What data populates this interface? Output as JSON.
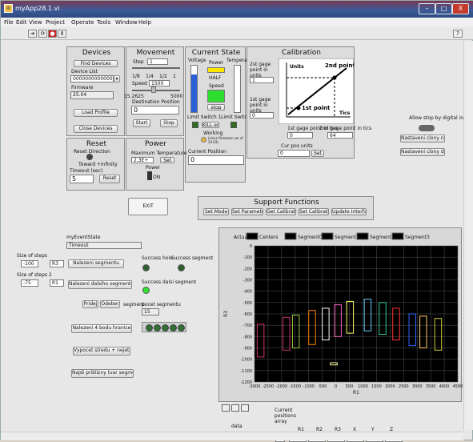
{
  "window": {
    "title": "myApp28.1.vi",
    "min": "–",
    "max": "□",
    "close": "X"
  },
  "menu": [
    "File",
    "Edit",
    "View",
    "Project",
    "Operate",
    "Tools",
    "Window",
    "Help"
  ],
  "devices": {
    "title": "Devices",
    "find": "Find Devices",
    "list_label": "Device List",
    "list_value": "000000000000007615",
    "firmware_label": "Firmware",
    "firmware_value": "25.04",
    "load": "Load Profile",
    "close": "Close Devices"
  },
  "movement": {
    "title": "Movement",
    "step_label": "Step",
    "step_value": "1",
    "frac1": "1/8",
    "frac2": "1/4",
    "frac3": "1/2",
    "frac4": "1",
    "speed_label": "Speed",
    "speed_value": "1500",
    "range_min": "15.2625",
    "range_max": "5000",
    "dest_label": "Destination Position",
    "dest_value": "0",
    "start": "Start",
    "stop": "Stop"
  },
  "state": {
    "title": "Current State",
    "voltage": "Voltage",
    "power": "Power",
    "temperature": "Temperature",
    "half": "HALF",
    "speed": "Speed",
    "stop": "stop",
    "ls1": "Limit Switch 1",
    "ls2": "Limit Switch 2",
    "kill": "KILL error",
    "working": "Working",
    "note": "(since firmware ver of 24.03)",
    "cur_pos_label": "Current Position",
    "cur_pos_value": "0"
  },
  "calibration": {
    "title": "Calibration",
    "p2_label": "2st gage point in units",
    "p2_value": "1",
    "p1_label": "1st gage point in units",
    "p1_value": "0",
    "units": "Units",
    "tics": "Tics",
    "second": "2nd point",
    "first": "1st point",
    "t1_label": "1st gage point in tics",
    "t1_value": "0",
    "t2_label": "2nd gage point in tics",
    "t2_value": "64",
    "cur_label": "Cur pos units",
    "cur_value": "0",
    "set": "Set"
  },
  "reset": {
    "title": "Reset",
    "dir_label": "Reset Direction",
    "dir_value": "Toward +infinity",
    "timeout_label": "Timeout (sec)",
    "timeout_value": "5",
    "btn": "Reset"
  },
  "power": {
    "title": "Power",
    "max_temp_label": "Maximum Temperature",
    "max_temp_value": "2,3E+",
    "set": "Set",
    "power_label": "Power",
    "on": "ON"
  },
  "right": {
    "allow": "Allow stop by digital input",
    "up": "Nastaveni clony nahoru",
    "down": "Nastaveni clony dolů"
  },
  "support": {
    "title": "Support Functions",
    "buttons": [
      "Set Mode",
      "Set Parameters",
      "Get Calibration",
      "Set Calibration",
      "Update Interface"
    ]
  },
  "exit": "EXIT",
  "event": {
    "label": "myEventState",
    "value": "Timeout"
  },
  "steps": {
    "label1": "Size of steps",
    "value1": "-100",
    "r1": "R3",
    "label2": "Size of steps 2",
    "value2": "-75",
    "r2": "R1"
  },
  "seg_buttons": {
    "b1": "Nalezeni segmentu",
    "b2": "Nalezeni dalsiho segmentu",
    "pridej": "Pridej",
    "odeber": "Odeber",
    "segment": "segment",
    "b3": "Nalezeni 4 bodu hranice",
    "b4": "Vypocet stredu + nejeti",
    "b5": "Najdi priblizny tvar segmentu"
  },
  "success": {
    "hole": "Success hole",
    "segment": "Success segment",
    "dalsi": "Success dalsi segment",
    "pocet_label": "pocet segmentu",
    "pocet_value": "15"
  },
  "data_ctrl": {
    "label": "data",
    "index": "0"
  },
  "positions": {
    "label": "Current positions array",
    "index": "0",
    "headers": [
      "R1",
      "R2",
      "R3",
      "X",
      "Y",
      "Z"
    ],
    "values": [
      "0",
      "0,5",
      "0",
      "0,5",
      "0,5",
      "0,5"
    ]
  },
  "chart_data": {
    "type": "line",
    "legend": [
      "Actual",
      "Centers",
      "Segment0",
      "Segment1",
      "Segment2",
      "Segment3"
    ],
    "xlabel": "R1",
    "ylabel": "R3",
    "xlim": [
      -3000,
      4500
    ],
    "ylim": [
      -1200,
      0
    ],
    "xticks": [
      "-3000",
      "-2500",
      "-2000",
      "-1500",
      "-1000",
      "-500",
      "0",
      "500",
      "1000",
      "1500",
      "2000",
      "2500",
      "3000",
      "3500",
      "4000",
      "4500"
    ],
    "yticks": [
      "0",
      "-100",
      "-200",
      "-300",
      "-400",
      "-500",
      "-600",
      "-700",
      "-800",
      "-900",
      "-1000",
      "-1100",
      "-1200"
    ],
    "segments": [
      {
        "color": "#cc3366",
        "x": [
          -2900,
          -2650
        ],
        "y": [
          -980,
          -690
        ]
      },
      {
        "color": "#cc3366",
        "x": [
          -1950,
          -1700
        ],
        "y": [
          -920,
          -630
        ]
      },
      {
        "color": "#99cc33",
        "x": [
          -1600,
          -1350
        ],
        "y": [
          -900,
          -610
        ]
      },
      {
        "color": "#ff8800",
        "x": [
          -1000,
          -750
        ],
        "y": [
          -870,
          -570
        ]
      },
      {
        "color": "#ffffff",
        "x": [
          -500,
          -250
        ],
        "y": [
          -830,
          -550
        ]
      },
      {
        "color": "#ff66cc",
        "x": [
          -50,
          200
        ],
        "y": [
          -800,
          -520
        ]
      },
      {
        "color": "#ffff66",
        "x": [
          400,
          650
        ],
        "y": [
          -770,
          -490
        ]
      },
      {
        "color": "#66ccff",
        "x": [
          1050,
          1300
        ],
        "y": [
          -750,
          -470
        ]
      },
      {
        "color": "#33cc99",
        "x": [
          1600,
          1850
        ],
        "y": [
          -780,
          -500
        ]
      },
      {
        "color": "#ff3333",
        "x": [
          2100,
          2350
        ],
        "y": [
          -830,
          -550
        ]
      },
      {
        "color": "#3366ff",
        "x": [
          2700,
          2950
        ],
        "y": [
          -880,
          -600
        ]
      },
      {
        "color": "#ffcc66",
        "x": [
          3100,
          3350
        ],
        "y": [
          -900,
          -620
        ]
      },
      {
        "color": "#cccc33",
        "x": [
          3650,
          3900
        ],
        "y": [
          -920,
          -640
        ]
      },
      {
        "color": "#ffffaa",
        "x": [
          -200,
          50
        ],
        "y": [
          -1050,
          -1030
        ]
      }
    ]
  }
}
